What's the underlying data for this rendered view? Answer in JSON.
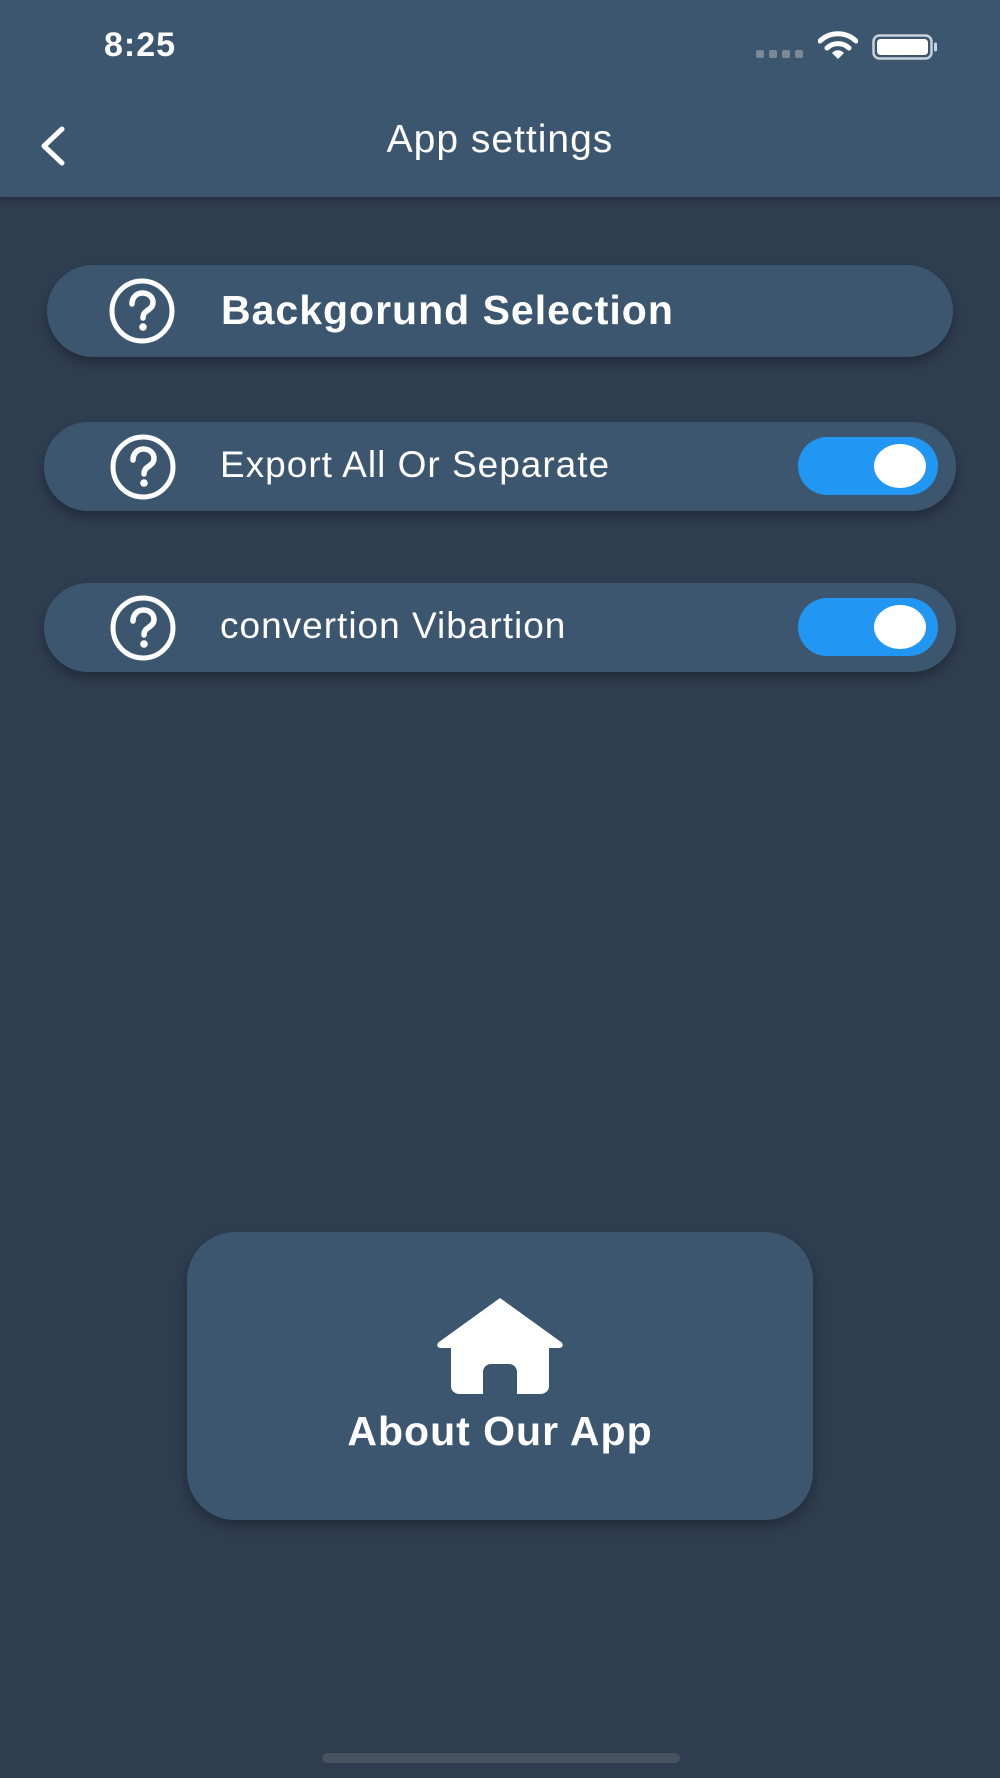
{
  "status_bar": {
    "time": "8:25",
    "icons": [
      "signal-icon",
      "wifi-icon",
      "battery-icon"
    ]
  },
  "app_bar": {
    "title": "App settings",
    "back_icon": "chevron-left-icon"
  },
  "settings": [
    {
      "label": "Backgorund Selection",
      "icon": "help-circle-icon",
      "has_toggle": false
    },
    {
      "label": "Export All Or Separate",
      "icon": "help-circle-icon",
      "has_toggle": true,
      "toggle_on": true
    },
    {
      "label": "convertion Vibartion",
      "icon": "help-circle-icon",
      "has_toggle": true,
      "toggle_on": true
    }
  ],
  "about_card": {
    "label": "About Our App",
    "icon": "home-icon"
  },
  "colors": {
    "background": "#2e3d50",
    "surface": "#3c566f",
    "accent": "#2196f3",
    "text": "#ffffff"
  }
}
